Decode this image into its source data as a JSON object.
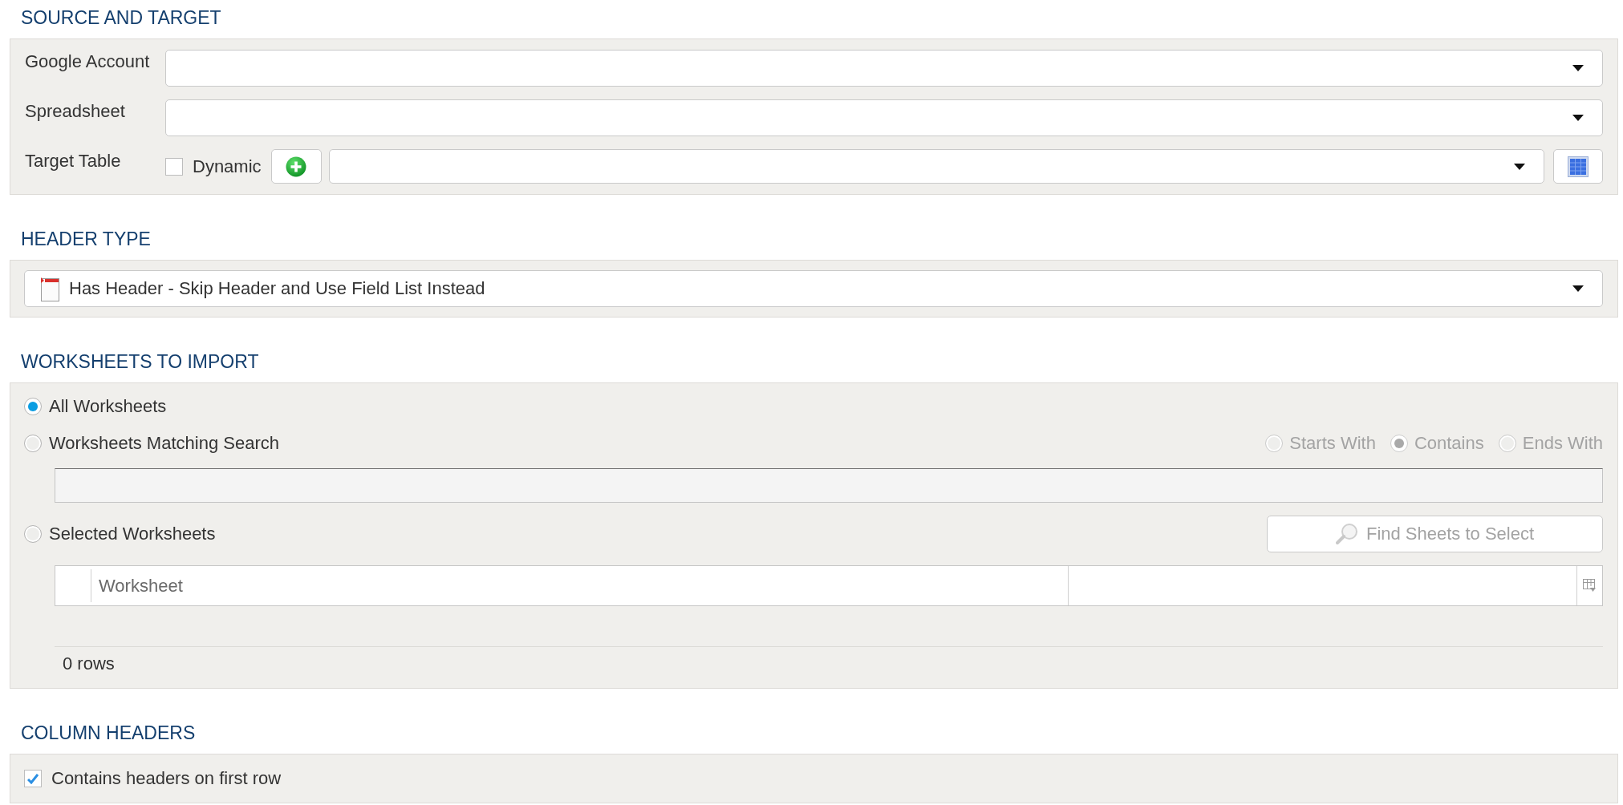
{
  "source_and_target": {
    "title": "SOURCE AND TARGET",
    "rows": [
      {
        "kind": "dropdown",
        "label": "Google Account"
      },
      {
        "kind": "dropdown",
        "label": "Spreadsheet"
      },
      {
        "kind": "target_table",
        "label": "Target Table",
        "dynamic": {
          "label": "Dynamic",
          "checked": false
        }
      }
    ]
  },
  "header_type": {
    "title": "HEADER TYPE",
    "value": "Has Header - Skip Header and Use Field List Instead"
  },
  "worksheets_to_import": {
    "title": "WORKSHEETS TO IMPORT",
    "options": [
      {
        "kind": "plain",
        "label": "All Worksheets",
        "selected": true
      },
      {
        "kind": "search",
        "label": "Worksheets Matching Search",
        "selected": false,
        "match_modes": [
          {
            "label": "Starts With",
            "selected": false,
            "disabled": true
          },
          {
            "label": "Contains",
            "selected": true,
            "disabled": true
          },
          {
            "label": "Ends With",
            "selected": false,
            "disabled": true
          }
        ],
        "search_field": {
          "disabled": true
        }
      },
      {
        "kind": "grid",
        "label": "Selected Worksheets",
        "selected": false,
        "find_button": {
          "label": "Find Sheets to Select",
          "disabled": true
        },
        "grid": {
          "columns": [
            {
              "label": "Worksheet"
            }
          ]
        },
        "row_count": "0 rows"
      }
    ]
  },
  "column_headers": {
    "title": "COLUMN HEADERS",
    "checkbox": {
      "label": "Contains headers on first row",
      "checked": true
    }
  }
}
